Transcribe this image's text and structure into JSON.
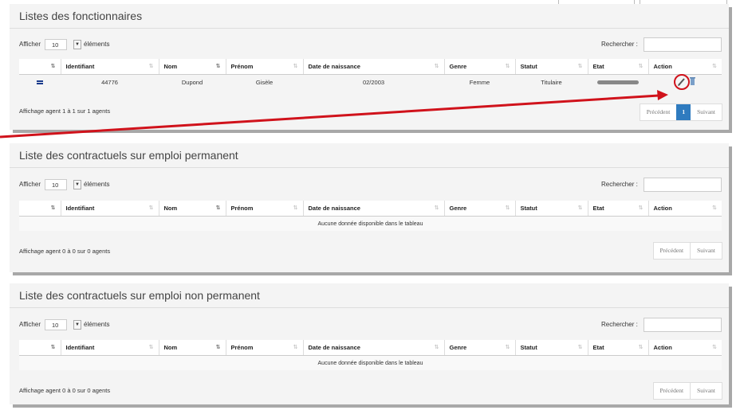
{
  "common": {
    "afficher": "Afficher",
    "page_size": "10",
    "elements": "éléments",
    "rechercher": "Rechercher :",
    "columns": [
      "Identifiant",
      "Nom",
      "Prénom",
      "Date de naissance",
      "Genre",
      "Statut",
      "Etat",
      "Action"
    ],
    "prev": "Précédent",
    "next": "Suivant",
    "empty_text": "Aucune donnée disponible dans le tableau"
  },
  "fonctionnaires": {
    "title": "Listes des fonctionnaires",
    "row": {
      "identifiant": "44776",
      "nom": "Dupond",
      "prenom": "Gisèle",
      "date": "02/2003",
      "genre": "Femme",
      "statut": "Titulaire"
    },
    "info": "Affichage agent 1 à 1 sur 1 agents",
    "current_page": "1"
  },
  "permanent": {
    "title": "Liste des contractuels sur emploi permanent",
    "info": "Affichage agent 0 à 0 sur 0 agents"
  },
  "non_permanent": {
    "title": "Liste des contractuels sur emploi non permanent",
    "info": "Affichage agent 0 à 0 sur 0 agents"
  },
  "colors": {
    "accent": "#2f7bbf",
    "annotation": "#d0121b",
    "status_bar": "#888888",
    "row_icon": "#1a3b8c"
  },
  "icons": [
    "sort-icon",
    "sort-alpha-icon",
    "edit-pencil-icon",
    "delete-trash-icon",
    "row-status-icon",
    "dropdown-caret-icon"
  ]
}
